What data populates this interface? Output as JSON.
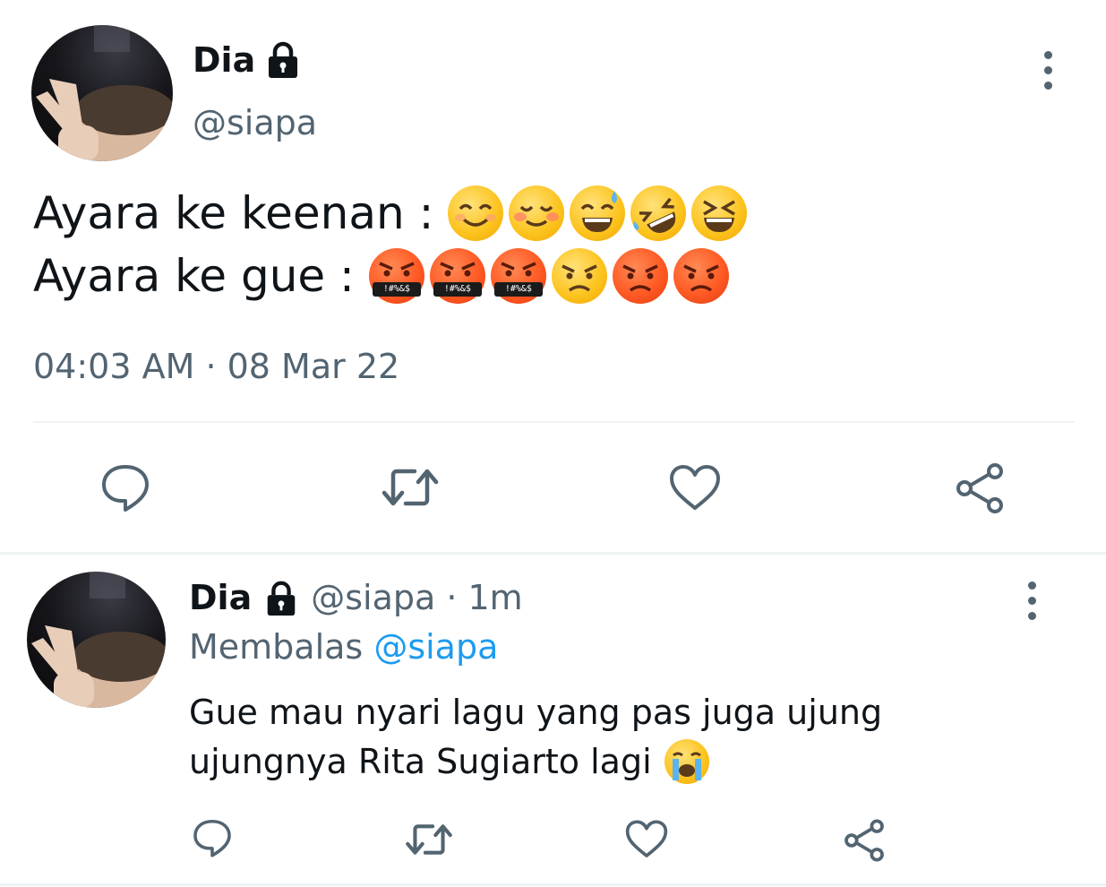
{
  "main_tweet": {
    "display_name": "Dia",
    "handle": "@siapa",
    "line1_text": "Ayara ke keenan :",
    "line2_text": "Ayara ke gue :",
    "line1_emojis": [
      "smiling-face-icon",
      "blushing-face-icon",
      "sweat-smile-face-icon",
      "rofl-face-icon",
      "squinting-laugh-face-icon"
    ],
    "line2_emojis": [
      "cursing-face-icon",
      "cursing-face-icon",
      "cursing-face-icon",
      "annoyed-face-icon",
      "angry-face-icon",
      "angry-face-icon"
    ],
    "curse_symbols": "!#%&$",
    "timestamp": "04:03 AM · 08 Mar 22"
  },
  "reply_tweet": {
    "display_name": "Dia",
    "handle_time": "@siapa · 1m",
    "replying_prefix": "Membalas",
    "replying_to": "@siapa",
    "text_line1": "Gue mau nyari lagu yang pas juga ujung",
    "text_line2": "ujungnya Rita Sugiarto lagi"
  },
  "colors": {
    "text": "#0f1419",
    "muted": "#536471",
    "link": "#1d9bf0",
    "divider": "#eff3f4"
  }
}
